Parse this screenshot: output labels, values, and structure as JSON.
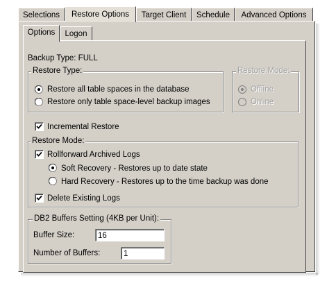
{
  "tabs": {
    "selections": "Selections",
    "restore_options": "Restore Options",
    "target_client": "Target Client",
    "schedule": "Schedule",
    "advanced_options": "Advanced Options",
    "active": "Restore Options"
  },
  "subtabs": {
    "options": "Options",
    "logon": "Logon",
    "active": "Options"
  },
  "backup_type": "Backup Type: FULL",
  "restore_type": {
    "title": "Restore Type:",
    "option_all": "Restore all table spaces in the database",
    "option_only": "Restore only table space-level backup images",
    "selected": "option_all"
  },
  "restore_mode_disabled": {
    "title": "Restore Mode:",
    "offline": "Offline",
    "online": "Online",
    "selected": "offline",
    "enabled": false
  },
  "incremental_restore": {
    "label": "Incremental Restore",
    "checked": true
  },
  "restore_mode": {
    "title": "Restore Mode:",
    "rollforward_label": "Rollforward Archived Logs",
    "rollforward_checked": true,
    "soft_recovery": "Soft Recovery - Restores up to date state",
    "hard_recovery": "Hard Recovery - Restores up to the time backup was done",
    "recovery_selected": "soft",
    "delete_logs_label": "Delete Existing Logs",
    "delete_logs_checked": true
  },
  "db2_buffers": {
    "title": "DB2 Buffers Setting (4KB per Unit):",
    "buffer_size_label": "Buffer Size:",
    "buffer_size_value": "16",
    "num_buffers_label": "Number of Buffers:",
    "num_buffers_value": "1"
  },
  "colors": {
    "dialog_face": "#d4d0c8",
    "highlight": "#ffffff",
    "shadow": "#808080",
    "dark_shadow": "#404040",
    "disabled_text": "#a0a0a0"
  }
}
